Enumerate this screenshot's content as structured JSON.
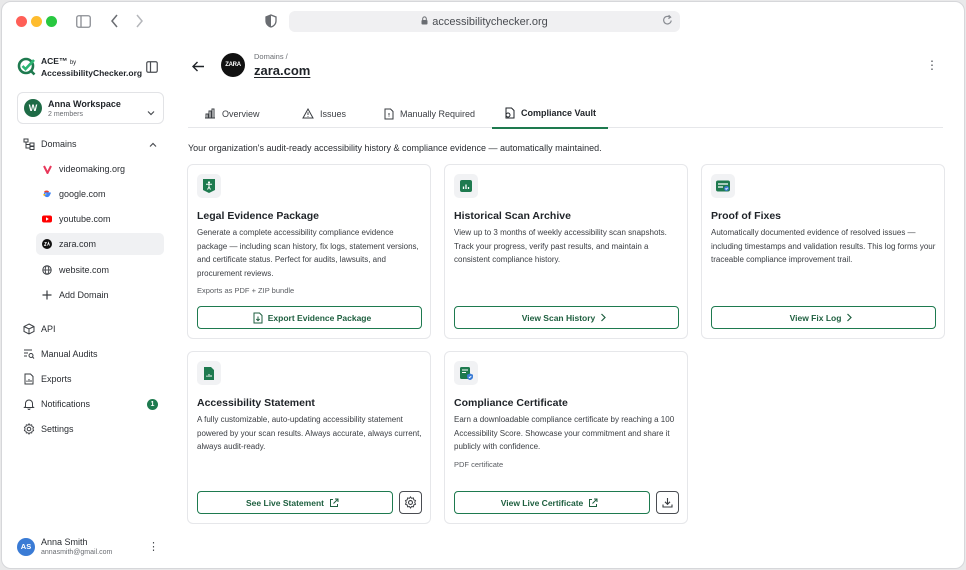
{
  "browser": {
    "url": "accessibilitychecker.org"
  },
  "brand": {
    "name_line1": "ACE™",
    "name_by": "by",
    "name_line2": "AccessibilityChecker.org"
  },
  "workspace": {
    "initial": "W",
    "name": "Anna Workspace",
    "members": "2 members"
  },
  "sidebar": {
    "domains_label": "Domains",
    "domains": [
      {
        "label": "videomaking.org",
        "icon": "videomaking-favicon"
      },
      {
        "label": "google.com",
        "icon": "google-favicon"
      },
      {
        "label": "youtube.com",
        "icon": "youtube-favicon"
      },
      {
        "label": "zara.com",
        "icon": "zara-favicon"
      },
      {
        "label": "website.com",
        "icon": "globe-icon"
      }
    ],
    "add_domain": "Add Domain",
    "items": [
      {
        "label": "API",
        "icon": "cube-icon"
      },
      {
        "label": "Manual Audits",
        "icon": "list-search-icon"
      },
      {
        "label": "Exports",
        "icon": "file-chart-icon"
      },
      {
        "label": "Notifications",
        "icon": "bell-icon"
      },
      {
        "label": "Settings",
        "icon": "gear-icon"
      }
    ],
    "notifications_count": "1"
  },
  "user": {
    "initials": "AS",
    "name": "Anna Smith",
    "email": "annasmith@gmail.com"
  },
  "header": {
    "breadcrumb": "Domains /",
    "site_logo_text": "ZARA",
    "title": "zara.com"
  },
  "tabs": [
    {
      "label": "Overview"
    },
    {
      "label": "Issues"
    },
    {
      "label": "Manually Required"
    },
    {
      "label": "Compliance Vault"
    }
  ],
  "intro": "Your organization's audit-ready accessibility history & compliance evidence — automatically maintained.",
  "cards": [
    {
      "title": "Legal Evidence Package",
      "description": "Generate a complete accessibility compliance evidence package — including scan history, fix logs, statement versions, and certificate status. Perfect for audits, lawsuits, and procurement reviews.",
      "note": "Exports as PDF + ZIP bundle",
      "button": "Export Evidence Package"
    },
    {
      "title": "Historical Scan Archive",
      "description": "View up to 3 months of weekly accessibility scan snapshots. Track your progress, verify past results, and maintain a consistent compliance history.",
      "button": "View Scan History"
    },
    {
      "title": "Proof of Fixes",
      "description": "Automatically documented evidence of resolved issues — including timestamps and validation results. This log forms your traceable compliance improvement trail.",
      "button": "View Fix Log"
    },
    {
      "title": "Accessibility Statement",
      "description": "A fully customizable, auto-updating accessibility statement powered by your scan results. Always accurate, always current, always audit-ready.",
      "button": "See Live Statement"
    },
    {
      "title": "Compliance Certificate",
      "description": "Earn a downloadable compliance certificate by reaching a 100 Accessibility Score. Showcase your commitment and share it publicly with confidence.",
      "note": "PDF certificate",
      "button": "View Live Certificate"
    }
  ],
  "colors": {
    "accent": "#1e7a4f",
    "traffic_red": "#ff5f57",
    "traffic_yellow": "#febc2e",
    "traffic_green": "#28c840"
  }
}
